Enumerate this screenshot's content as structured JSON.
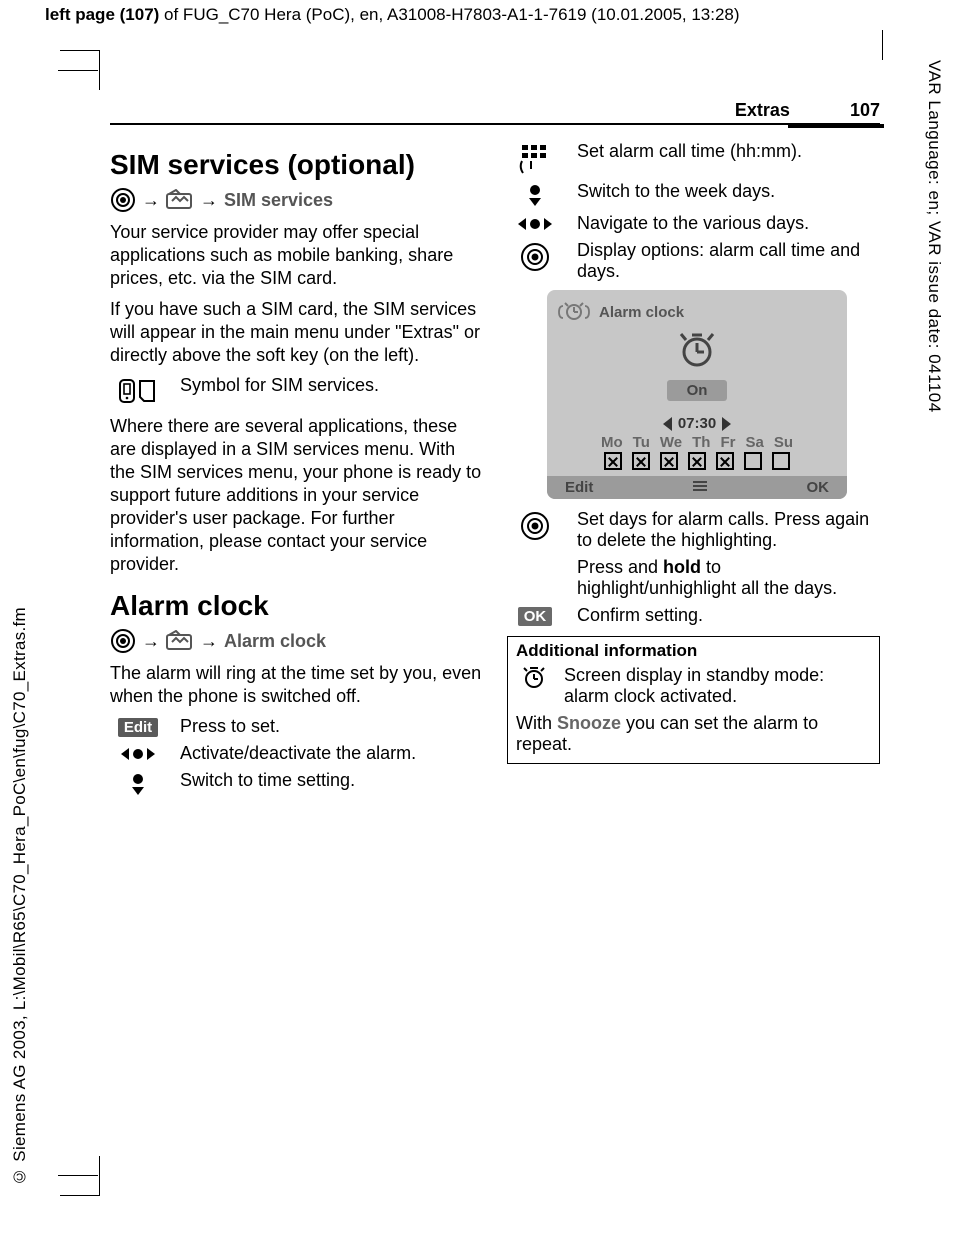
{
  "header": {
    "page_label_prefix": "left page (107)",
    "page_label_rest": " of FUG_C70 Hera (PoC), en, A31008-H7803-A1-1-7619 (10.01.2005, 13:28)"
  },
  "margins": {
    "right_vertical": "VAR Language: en; VAR issue date: 041104",
    "left_vertical": "© Siemens AG 2003, L:\\Mobil\\R65\\C70_Hera_PoC\\en\\fug\\C70_Extras.fm"
  },
  "running_head": {
    "section": "Extras",
    "page": "107"
  },
  "left": {
    "h_sim": "SIM services (optional)",
    "nav_sim": "SIM services",
    "p1": "Your service provider may offer special applications such as mobile banking, share prices, etc. via the SIM card.",
    "p2": "If you have such a SIM card, the SIM services will appear in the main menu under \"Extras\" or directly above the soft key (on the left).",
    "sim_symbol_text": "Symbol for SIM services.",
    "p3": "Where there are several applications, these are displayed in a SIM services menu. With the SIM services menu, your phone is ready to support future additions in your service provider's user package. For further information, please contact your service provider.",
    "h_alarm": "Alarm clock",
    "nav_alarm": "Alarm clock",
    "p4": "The alarm will ring at the time set by you, even when the phone is switched off.",
    "edit_label": "Edit",
    "edit_text": "Press to set.",
    "lr_text": "Activate/deactivate the alarm.",
    "down_text": "Switch to time setting."
  },
  "right": {
    "r1": "Set alarm call time (hh:mm).",
    "r2": "Switch to the week days.",
    "r3": "Navigate to the various days.",
    "r4": "Display options: alarm call time and days.",
    "r5": "Set days for alarm calls. Press again to delete the highlighting.",
    "r6a": "Press and ",
    "r6b": "hold",
    "r6c": " to highlight/unhighlight all the days.",
    "ok_label": "OK",
    "ok_text": "Confirm setting."
  },
  "phone": {
    "title": "Alarm clock",
    "state": "On",
    "time": "07:30",
    "days": [
      "Mo",
      "Tu",
      "We",
      "Th",
      "Fr",
      "Sa",
      "Su"
    ],
    "checked": [
      true,
      true,
      true,
      true,
      true,
      false,
      false
    ],
    "soft_left": "Edit",
    "soft_right": "OK"
  },
  "info": {
    "title": "Additional information",
    "line1": "Screen display in standby mode: alarm clock activated.",
    "line2a": "With ",
    "line2b": "Snooze",
    "line2c": " you can set the alarm to repeat."
  }
}
